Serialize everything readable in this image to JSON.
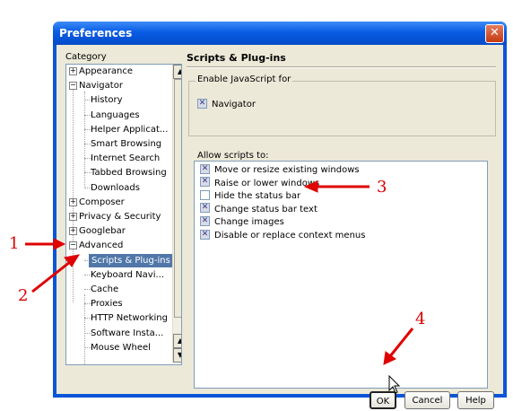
{
  "window": {
    "title": "Preferences",
    "close_symbol": "✕"
  },
  "category": {
    "label": "Category",
    "items": [
      {
        "label": "Appearance",
        "exp": "+"
      },
      {
        "label": "Navigator",
        "exp": "−"
      },
      {
        "label": "History"
      },
      {
        "label": "Languages"
      },
      {
        "label": "Helper Applicat..."
      },
      {
        "label": "Smart Browsing"
      },
      {
        "label": "Internet Search"
      },
      {
        "label": "Tabbed Browsing"
      },
      {
        "label": "Downloads"
      },
      {
        "label": "Composer",
        "exp": "+"
      },
      {
        "label": "Privacy & Security",
        "exp": "+"
      },
      {
        "label": "Googlebar",
        "exp": "+"
      },
      {
        "label": "Advanced",
        "exp": "−"
      },
      {
        "label": "Scripts & Plug-ins",
        "selected": true
      },
      {
        "label": "Keyboard Navi..."
      },
      {
        "label": "Cache"
      },
      {
        "label": "Proxies"
      },
      {
        "label": "HTTP Networking"
      },
      {
        "label": "Software Insta..."
      },
      {
        "label": "Mouse Wheel"
      }
    ]
  },
  "panel": {
    "title": "Scripts & Plug-ins",
    "enable_js_legend": "Enable JavaScript for",
    "navigator_label": "Navigator",
    "allow_label": "Allow scripts to:",
    "options": [
      {
        "label": "Move or resize existing windows",
        "checked": true
      },
      {
        "label": "Raise or lower windows",
        "checked": true
      },
      {
        "label": "Hide the status bar",
        "checked": false
      },
      {
        "label": "Change status bar text",
        "checked": true
      },
      {
        "label": "Change images",
        "checked": true
      },
      {
        "label": "Disable or replace context menus",
        "checked": true
      }
    ]
  },
  "buttons": {
    "ok": "OK",
    "cancel": "Cancel",
    "help": "Help"
  },
  "annotations": {
    "n1": "1",
    "n2": "2",
    "n3": "3",
    "n4": "4"
  },
  "colors": {
    "annotation": "#d80000",
    "title_bar": "#0a5ce4",
    "selection": "#5177a8"
  }
}
